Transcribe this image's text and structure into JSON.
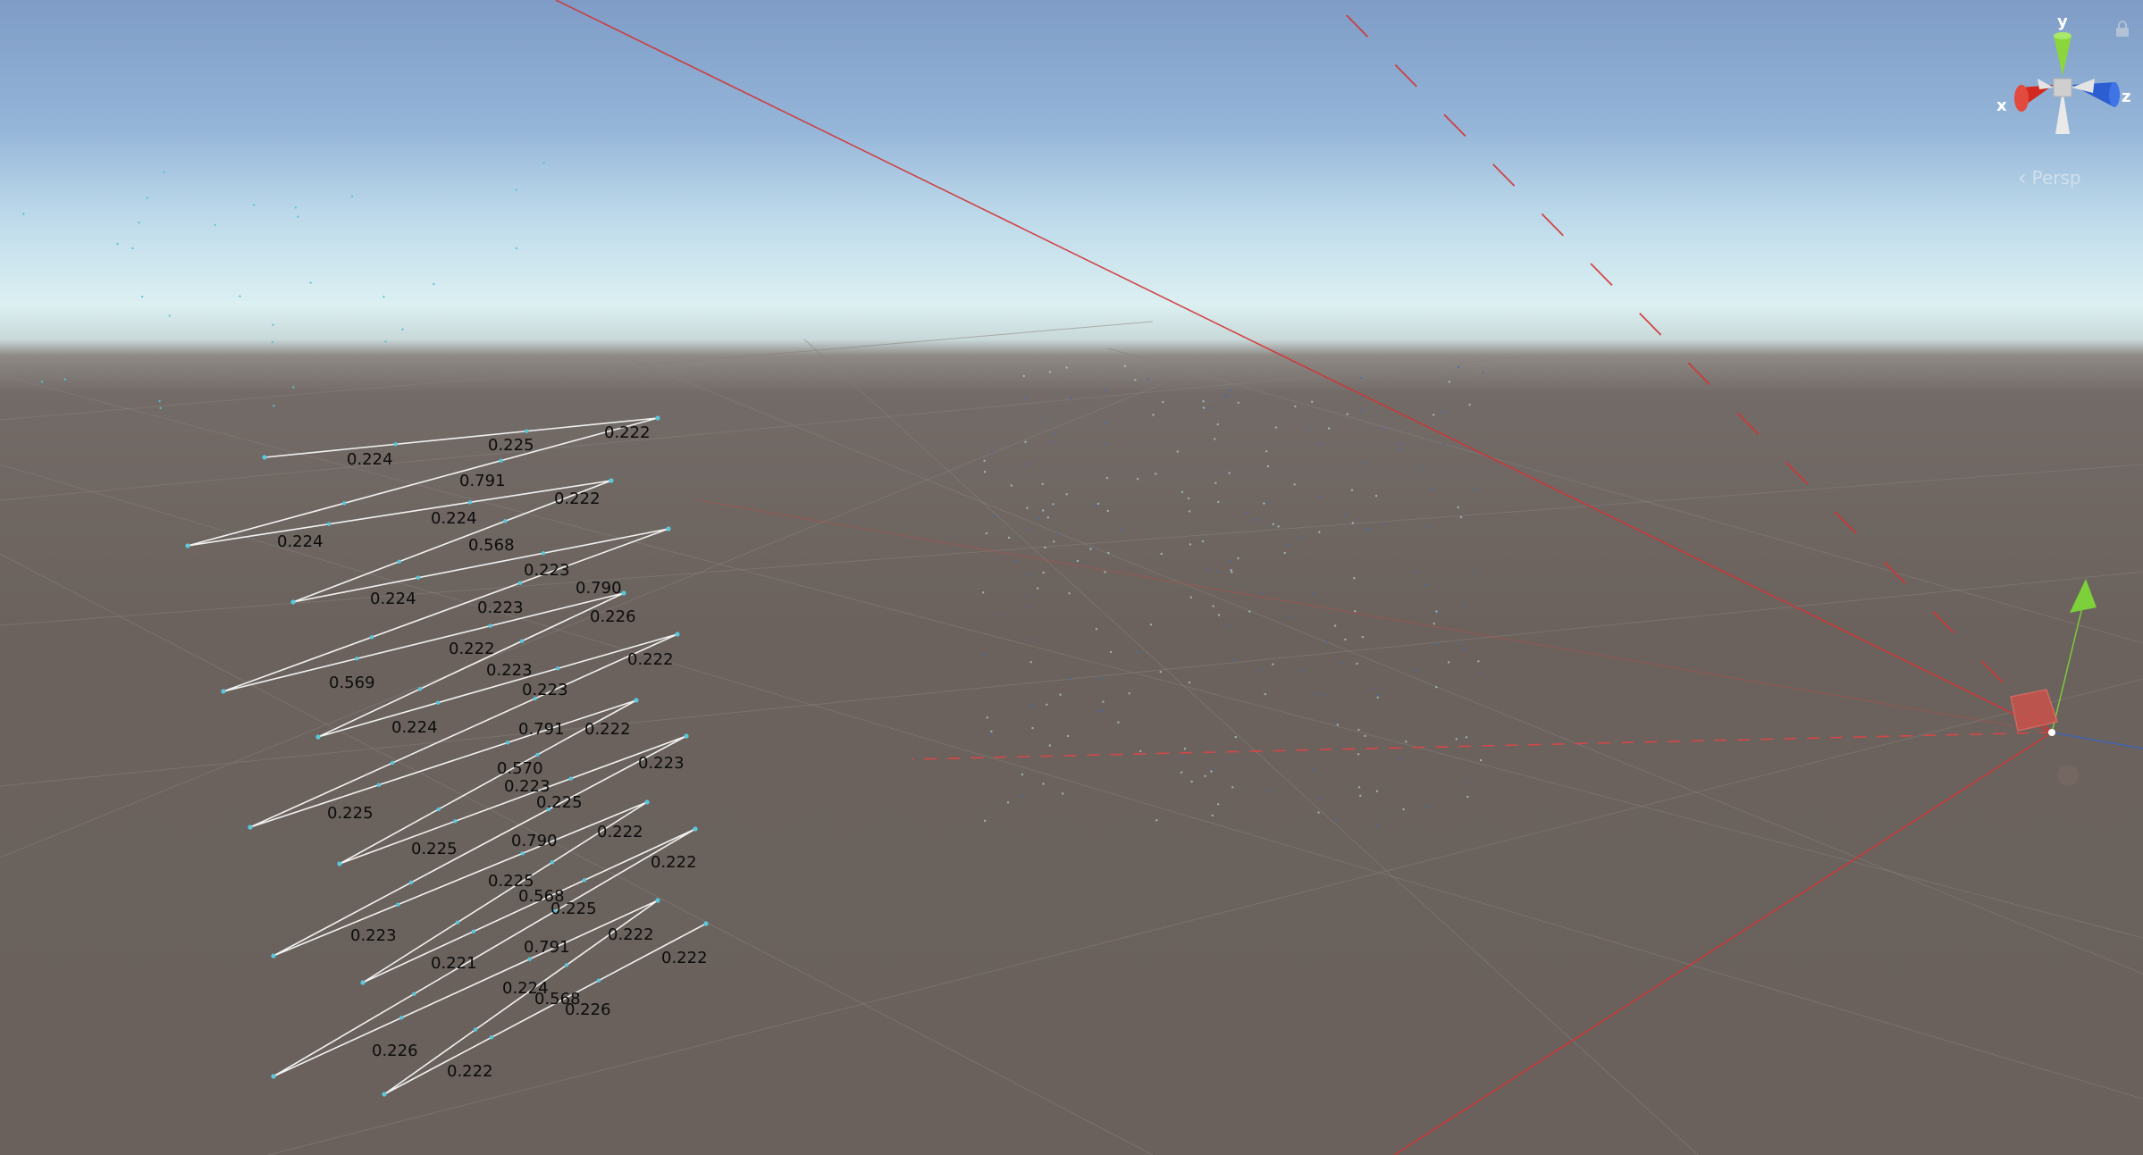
{
  "view": {
    "projection_label": "Persp",
    "axis_labels": {
      "x": "x",
      "y": "y",
      "z": "z"
    }
  },
  "measure_labels": [
    "0.224",
    "0.225",
    "0.222",
    "0.791",
    "0.224",
    "0.222",
    "0.224",
    "0.568",
    "0.223",
    "0.224",
    "0.223",
    "0.790",
    "0.222",
    "0.226",
    "0.569",
    "0.223",
    "0.222",
    "0.223",
    "0.224",
    "0.791",
    "0.222",
    "0.225",
    "0.570",
    "0.223",
    "0.223",
    "0.225",
    "0.225",
    "0.790",
    "0.222",
    "0.222",
    "0.225",
    "0.568",
    "0.225",
    "0.223",
    "0.791",
    "0.222",
    "0.221",
    "0.224",
    "0.222",
    "0.568",
    "0.226",
    "0.226",
    "0.222"
  ],
  "colors": {
    "sky_top": "#7e9cc6",
    "horizon": "#dcf0f2",
    "ground": "#6b625d",
    "measure_line": "#f2f2f2",
    "light_gizmo": "#d93b3b",
    "axis_x": "#d9342b",
    "axis_y": "#7ed03a",
    "axis_z": "#2f63d6"
  }
}
